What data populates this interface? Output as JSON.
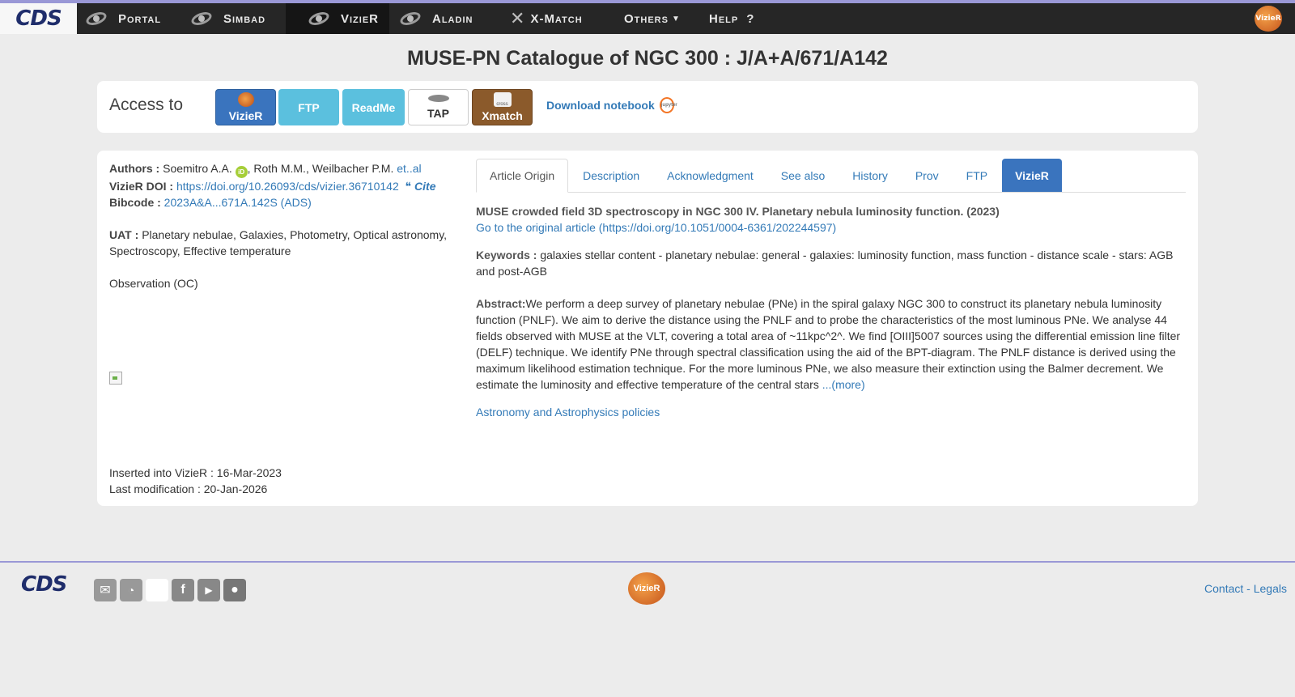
{
  "nav": {
    "logo": "CDS",
    "items": [
      {
        "label": "Portal"
      },
      {
        "label": "Simbad"
      },
      {
        "label": "VizieR"
      },
      {
        "label": "Aladin"
      },
      {
        "label": "X-Match"
      },
      {
        "label": "Others"
      },
      {
        "label": "Help"
      }
    ],
    "help_glyph": "?",
    "badge_text": "VizieR"
  },
  "title": "MUSE-PN Catalogue of NGC 300 : J/A+A/671/A142",
  "access": {
    "label": "Access to",
    "buttons": [
      "VizieR",
      "FTP",
      "ReadMe",
      "TAP",
      "Xmatch"
    ],
    "xmatch_icon_text": "cross",
    "download_notebook": "Download notebook",
    "jupyter_text": "jupyter"
  },
  "meta": {
    "authors_label": "Authors :",
    "authors_first": "Soemitro A.A.",
    "authors_rest": ", Roth M.M., Weilbacher P.M.",
    "et_al": "et..al",
    "orcid_text": "iD",
    "doi_label": "VizieR DOI :",
    "doi_url": "https://doi.org/10.26093/cds/vizier.36710142",
    "cite_label": "❝ Cite",
    "bibcode_label": "Bibcode :",
    "bibcode": "2023A&A...671A.142S (ADS)",
    "uat_label": "UAT :",
    "uat": "Planetary nebulae, Galaxies, Photometry, Optical astronomy, Spectroscopy, Effective temperature",
    "observation": "Observation (OC)",
    "inserted": "Inserted into VizieR : 16-Mar-2023",
    "modified": "Last modification : 20-Jan-2026"
  },
  "tabs": [
    "Article Origin",
    "Description",
    "Acknowledgment",
    "See also",
    "History",
    "Prov",
    "FTP",
    "VizieR"
  ],
  "article": {
    "title": "MUSE crowded field 3D spectroscopy in NGC 300 IV. Planetary nebula luminosity function. (2023)",
    "link": "Go to the original article (https://doi.org/10.1051/0004-6361/202244597)",
    "keywords_label": "Keywords :",
    "keywords": "galaxies stellar content - planetary nebulae: general - galaxies: luminosity function, mass function - distance scale - stars: AGB and post-AGB",
    "abstract_label": "Abstract:",
    "abstract": "We perform a deep survey of planetary nebulae (PNe) in the spiral galaxy NGC 300 to construct its planetary nebula luminosity function (PNLF). We aim to derive the distance using the PNLF and to probe the characteristics of the most luminous PNe. We analyse 44 fields observed with MUSE at the VLT, covering a total area of ~11kpc^2^. We find [OIII]5007 sources using the differential emission line filter (DELF) technique. We identify PNe through spectral classification using the aid of the BPT-diagram. The PNLF distance is derived using the maximum likelihood estimation technique. For the more luminous PNe, we also measure their extinction using the Balmer decrement. We estimate the luminosity and effective temperature of the central stars",
    "more": "...(more)",
    "policies": "Astronomy and Astrophysics policies"
  },
  "footer": {
    "logo": "CDS",
    "badge_text": "VizieR",
    "contact": "Contact",
    "separator": " - ",
    "legals": "Legals"
  }
}
